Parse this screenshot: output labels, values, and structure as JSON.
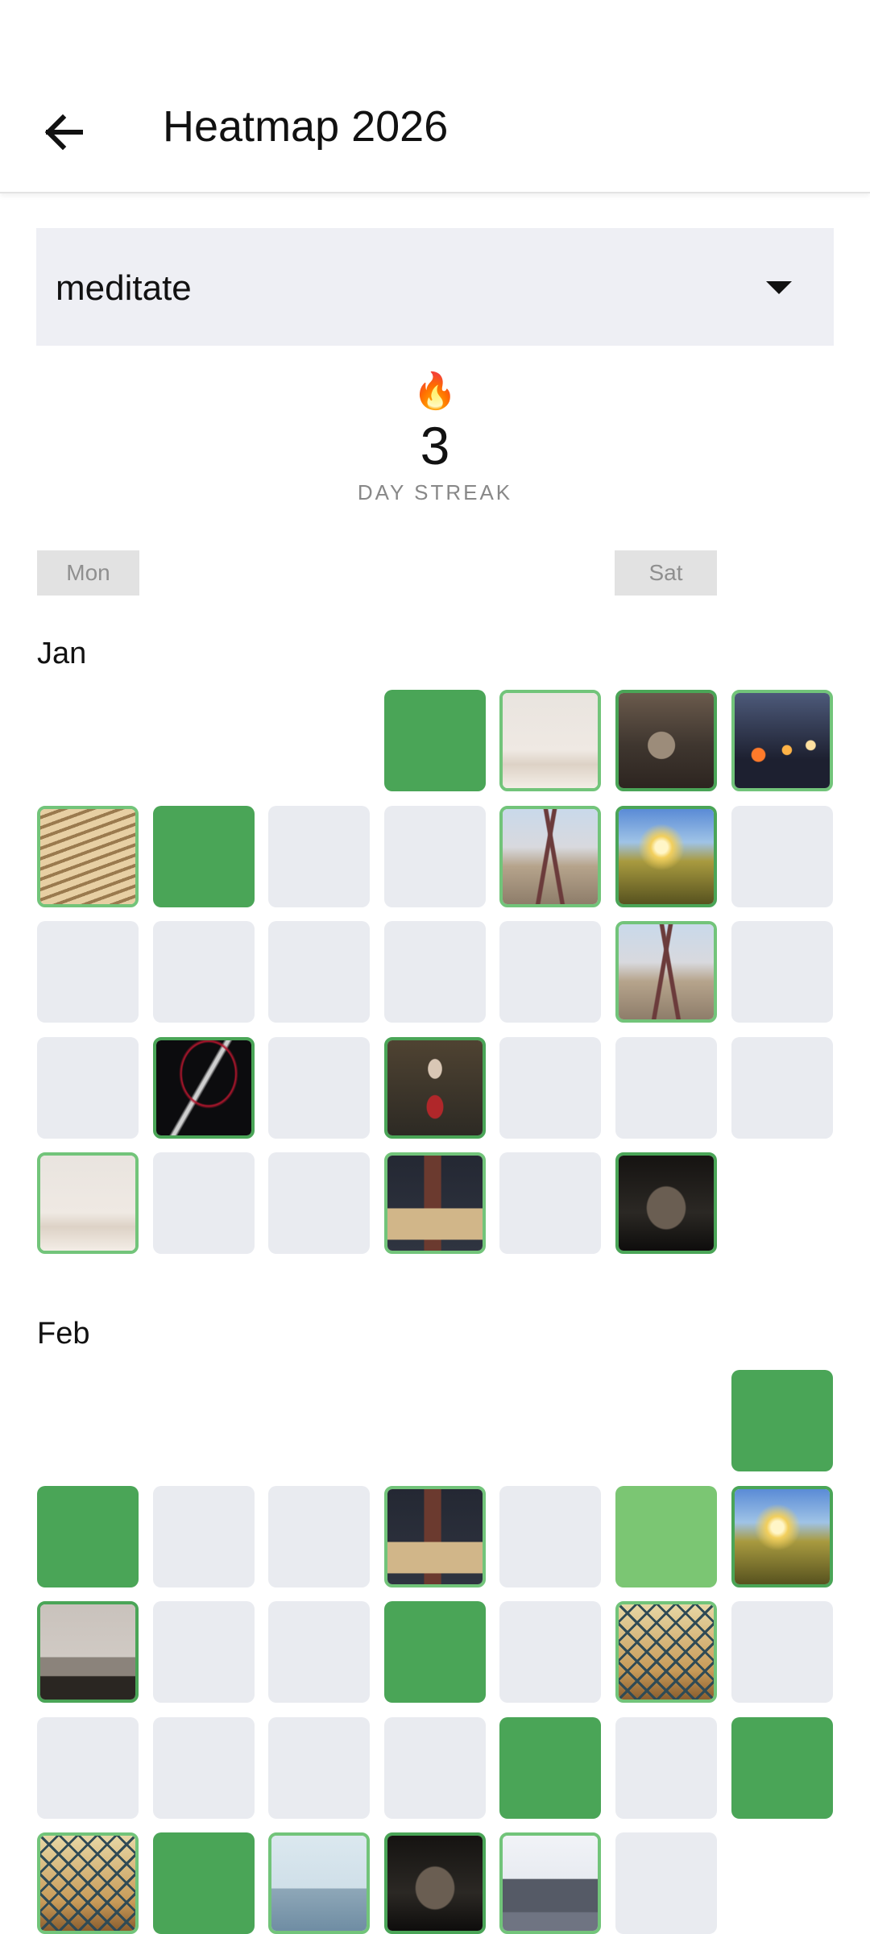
{
  "appbar": {
    "title": "Heatmap 2026",
    "back_icon": "arrow-left-icon"
  },
  "habit_select": {
    "value": "meditate",
    "caret_icon": "caret-down-icon"
  },
  "streak": {
    "icon": "🔥",
    "count": "3",
    "label": "DAY STREAK"
  },
  "weekday_labels": {
    "first": "Mon",
    "sixth": "Sat"
  },
  "months": [
    {
      "label": "Jan",
      "weeks": [
        [
          null,
          null,
          null,
          "done",
          "photo:palm-trees",
          "photo:wolf",
          "photo:city-lights-bokeh"
        ],
        [
          "photo:pens-in-box",
          "done",
          "empty",
          "empty",
          "photo:railway-coast",
          "photo:sunset-field",
          "empty"
        ],
        [
          "empty",
          "empty",
          "empty",
          "empty",
          "empty",
          "photo:railway-coast",
          "empty"
        ],
        [
          "empty",
          "photo:red-abstract",
          "empty",
          "photo:guitarist",
          "empty",
          "empty",
          "empty"
        ],
        [
          "photo:palm-trees",
          "empty",
          "empty",
          "photo:desk-top-view",
          "empty",
          "photo:vintage-car",
          null
        ]
      ]
    },
    {
      "label": "Feb",
      "weeks": [
        [
          null,
          null,
          null,
          null,
          null,
          null,
          "done"
        ],
        [
          "done",
          "empty",
          "empty",
          "photo:desk-top-view",
          "empty",
          "light",
          "photo:sunset-field"
        ],
        [
          "photo:person-by-sea",
          "empty",
          "empty",
          "done",
          "empty",
          "photo:glass-dome",
          "empty"
        ],
        [
          "empty",
          "empty",
          "empty",
          "empty",
          "done",
          "empty",
          "done"
        ],
        [
          "photo:glass-dome",
          "done",
          "photo:hill-view",
          "photo:vintage-car",
          "photo:city-skyline",
          "empty",
          null
        ]
      ]
    }
  ],
  "colors": {
    "done": "#4aa557",
    "light": "#7bc673",
    "empty": "#e9ebf0",
    "photo_border": "#72c47a"
  }
}
